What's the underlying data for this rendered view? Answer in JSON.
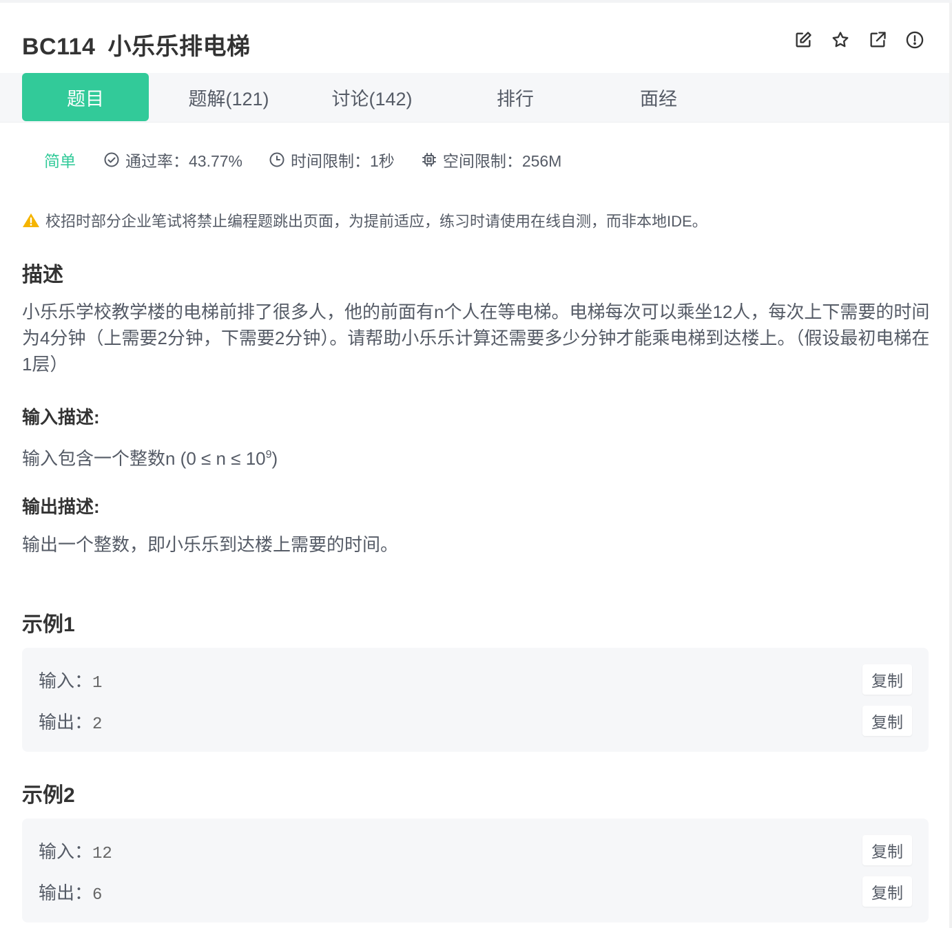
{
  "header": {
    "code": "BC114",
    "title": "小乐乐排电梯",
    "icons": [
      "edit-icon",
      "star-icon",
      "share-icon",
      "report-icon"
    ]
  },
  "tabs": [
    {
      "label": "题目",
      "active": true
    },
    {
      "label": "题解(121)"
    },
    {
      "label": "讨论(142)"
    },
    {
      "label": "排行"
    },
    {
      "label": "面经"
    }
  ],
  "meta": {
    "difficulty": "简单",
    "pass_rate": "通过率：43.77%",
    "time_limit": "时间限制：1秒",
    "space_limit": "空间限制：256M"
  },
  "warning": "校招时部分企业笔试将禁止编程题跳出页面，为提前适应，练习时请使用在线自测，而非本地IDE。",
  "description": {
    "heading": "描述",
    "text": "小乐乐学校教学楼的电梯前排了很多人，他的前面有n个人在等电梯。电梯每次可以乘坐12人，每次上下需要的时间为4分钟（上需要2分钟，下需要2分钟）。请帮助小乐乐计算还需要多少分钟才能乘电梯到达楼上。（假设最初电梯在1层）"
  },
  "input_desc": {
    "heading": "输入描述:",
    "text_before": "输入包含一个整数n (0 ≤ n ≤ 10",
    "exponent": "9",
    "text_after": ")"
  },
  "output_desc": {
    "heading": "输出描述:",
    "text": "输出一个整数，即小乐乐到达楼上需要的时间。"
  },
  "examples": [
    {
      "heading": "示例1",
      "input_label": "输入：",
      "input": "1",
      "output_label": "输出：",
      "output": "2",
      "copy": "复制"
    },
    {
      "heading": "示例2",
      "input_label": "输入：",
      "input": "12",
      "output_label": "输出：",
      "output": "6",
      "copy": "复制"
    }
  ],
  "colors": {
    "accent": "#32ca99",
    "text": "#333333",
    "muted": "#555b66",
    "panel": "#f6f7f9",
    "warning": "#f5b400"
  }
}
